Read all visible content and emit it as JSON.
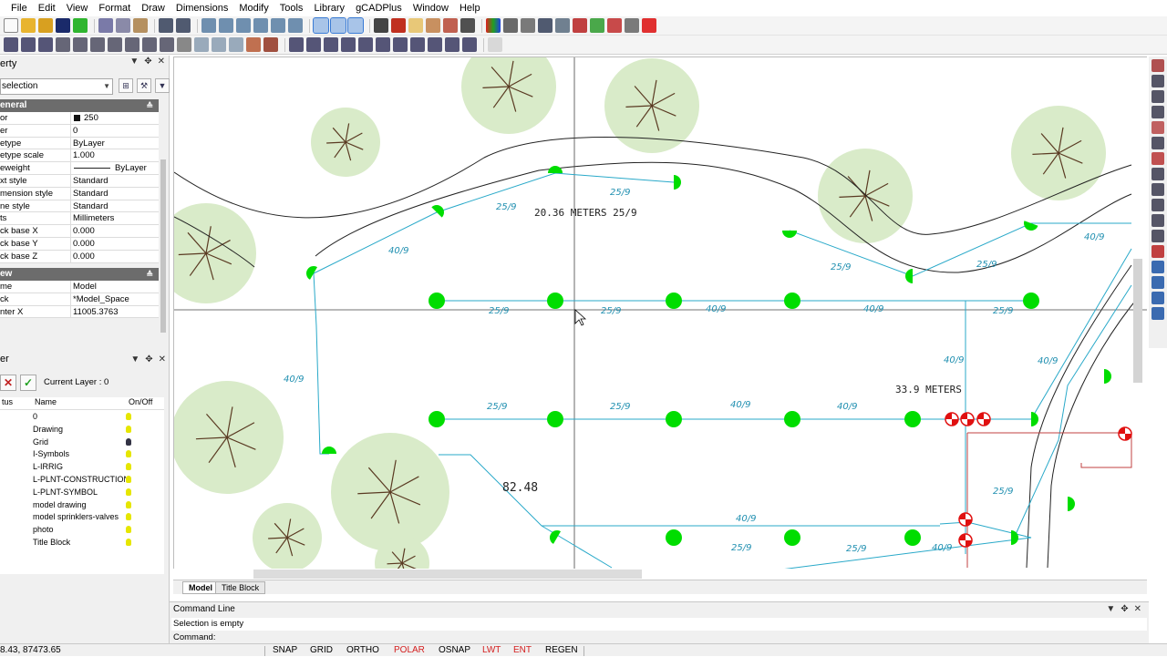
{
  "menu": [
    "File",
    "Edit",
    "View",
    "Format",
    "Draw",
    "Dimensions",
    "Modify",
    "Tools",
    "Library",
    "gCADPlus",
    "Window",
    "Help"
  ],
  "property_panel": {
    "title": "erty",
    "selection": "selection",
    "general_label": "eneral",
    "general_rows": [
      {
        "key": "or",
        "value": "250"
      },
      {
        "key": "er",
        "value": "0"
      },
      {
        "key": "etype",
        "value": "ByLayer"
      },
      {
        "key": "etype scale",
        "value": "1.000"
      },
      {
        "key": "eweight",
        "value": "ByLayer"
      },
      {
        "key": "xt style",
        "value": "Standard"
      },
      {
        "key": "mension style",
        "value": "Standard"
      },
      {
        "key": "ne style",
        "value": "Standard"
      },
      {
        "key": "ts",
        "value": "Millimeters"
      },
      {
        "key": "ck base X",
        "value": "0.000"
      },
      {
        "key": "ck base Y",
        "value": "0.000"
      },
      {
        "key": "ck base Z",
        "value": "0.000"
      }
    ],
    "view_label": "ew",
    "view_rows": [
      {
        "key": "me",
        "value": "Model"
      },
      {
        "key": "ck",
        "value": "*Model_Space"
      },
      {
        "key": "nter X",
        "value": "11005.3763"
      }
    ]
  },
  "layer_panel": {
    "title": "er",
    "current_layer": "Current Layer : 0",
    "col_status": "tus",
    "col_name": "Name",
    "col_onoff": "On/Off",
    "layers": [
      "0",
      "Drawing",
      "Grid",
      "I-Symbols",
      "L-IRRIG",
      "L-PLNT-CONSTRUCTION",
      "L-PLNT-SYMBOL",
      "model drawing",
      "model sprinklers-valves",
      "photo",
      "Title Block"
    ]
  },
  "drawing": {
    "labels": [
      {
        "id": "l1",
        "text": "20.36 METERS 25/9"
      },
      {
        "id": "l2",
        "text": "33.9 METERS"
      },
      {
        "id": "l3",
        "text": "82.48"
      }
    ],
    "nozzles": [
      "25/9",
      "40/9"
    ]
  },
  "tabs": [
    "Model",
    "Title Block"
  ],
  "command": {
    "title": "Command Line",
    "history": "Selection is empty",
    "prompt": "Command:"
  },
  "status": {
    "coords": "8.43, 87473.65",
    "buttons": [
      "SNAP",
      "GRID",
      "ORTHO",
      "POLAR",
      "OSNAP",
      "LWT",
      "ENT",
      "REGEN"
    ],
    "active_color": "#d42020"
  },
  "colors": {
    "accent_green": "#00dd00",
    "pipe": "#29a9c9",
    "label": "#1f8fb0",
    "tree": "#d9ebc9",
    "valve": "#e01010"
  }
}
